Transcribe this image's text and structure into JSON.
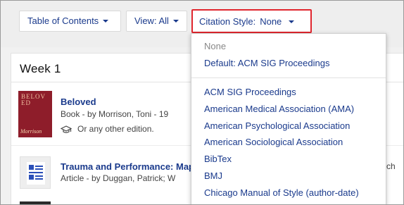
{
  "toolbar": {
    "toc_label": "Table of Contents",
    "view_label": "View: All",
    "citation_label": "Citation Style:",
    "citation_value": "None"
  },
  "section": {
    "title": "Week 1"
  },
  "items": [
    {
      "title": "Beloved",
      "meta": "Book   -  by Morrison, Toni   -  19",
      "edition": "Or any other edition.",
      "cover_text": "BELOVED",
      "cover_author": "Morrison"
    },
    {
      "title": "Trauma and Performance: Map",
      "meta": "Article   -  by Duggan, Patrick; W",
      "right_fragment": "ch"
    }
  ],
  "citation_menu": {
    "options_top": [
      "None",
      "Default: ACM SIG Proceedings"
    ],
    "options": [
      "ACM SIG Proceedings",
      "American Medical Association (AMA)",
      "American Psychological Association",
      "American Sociological Association",
      "BibTex",
      "BMJ",
      "Chicago Manual of Style (author-date)"
    ]
  },
  "colors": {
    "link": "#1a3a8c",
    "highlight_border": "#e0262e",
    "cover_bg": "#8e1d2a"
  }
}
